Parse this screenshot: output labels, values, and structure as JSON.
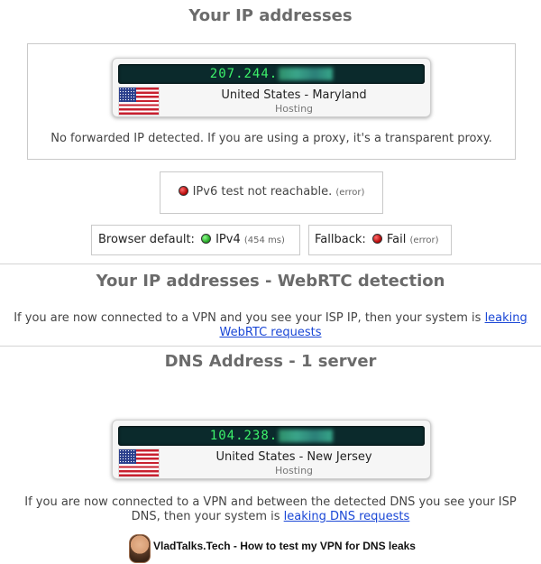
{
  "section1": {
    "title": "Your IP addresses",
    "ip_visible": "207.244.",
    "location": "United States - Maryland",
    "type": "Hosting",
    "forward_message": "No forwarded IP detected. If you are using a proxy, it's a transparent proxy."
  },
  "ipv6": {
    "label": "IPv6 test not reachable.",
    "note": "(error)"
  },
  "browser_default": {
    "label": "Browser default:",
    "protocol": "IPv4",
    "timing": "(454 ms)"
  },
  "fallback": {
    "label": "Fallback:",
    "status": "Fail",
    "note": "(error)"
  },
  "webrtc": {
    "title": "Your IP addresses - WebRTC detection",
    "message_prefix": "If you are now connected to a VPN and you see your ISP IP, then your system is",
    "link_text_1": "leaking",
    "link_text_2": "WebRTC requests"
  },
  "dns": {
    "title": "DNS Address - 1 server",
    "ip_visible": "104.238.",
    "location": "United States - New Jersey",
    "type": "Hosting",
    "message_line1": "If you are now connected to a VPN and between the detected DNS you see your ISP",
    "message_prefix": "DNS, then your system is",
    "link_text": "leaking DNS requests"
  },
  "footer": {
    "text": "VladTalks.Tech - How to test my VPN for DNS leaks"
  },
  "colors": {
    "ip_text": "#3df26b",
    "ip_bar": "#0b2a2c",
    "link": "#1a47d6",
    "title": "#6b6b6b"
  },
  "icons": [
    "us-flag-icon",
    "status-red-dot-icon",
    "status-green-dot-icon",
    "avatar-icon"
  ]
}
